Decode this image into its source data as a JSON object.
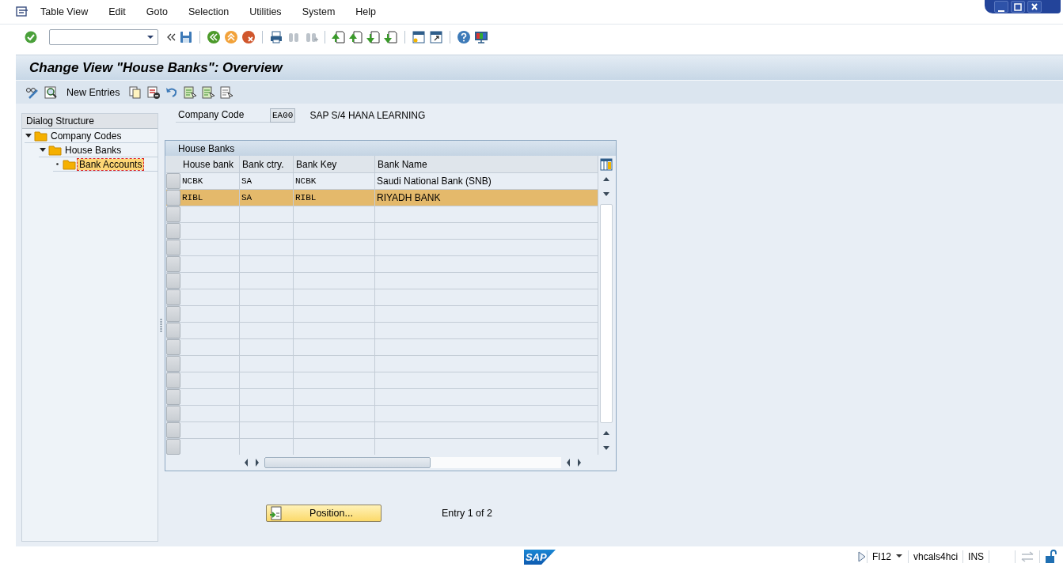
{
  "menu": [
    "Table View",
    "Edit",
    "Goto",
    "Selection",
    "Utilities",
    "System",
    "Help"
  ],
  "title": "Change View \"House Banks\": Overview",
  "app_toolbar": {
    "new_entries": "New Entries"
  },
  "dialog_structure": {
    "title": "Dialog Structure",
    "tree": [
      {
        "label": "Company Codes",
        "expanded": true,
        "selected": false,
        "children": [
          {
            "label": "House Banks",
            "expanded": true,
            "selected": false,
            "children": [
              {
                "label": "Bank Accounts",
                "selected": true
              }
            ]
          }
        ]
      }
    ]
  },
  "company_code": {
    "label": "Company Code",
    "value": "EA00",
    "description": "SAP S/4 HANA LEARNING"
  },
  "table": {
    "title": "House Banks",
    "columns": [
      "House bank",
      "Bank ctry.",
      "Bank Key",
      "Bank Name"
    ],
    "rows": [
      {
        "cells": [
          "NCBK",
          "SA",
          "NCBK",
          "Saudi National Bank (SNB)"
        ],
        "selected": false
      },
      {
        "cells": [
          "RIBL",
          "SA",
          "RIBL",
          "RIYADH BANK"
        ],
        "selected": true
      }
    ]
  },
  "position_button": "Position...",
  "entry_info": "Entry 1 of 2",
  "status_bar": {
    "logo": "SAP",
    "transaction": "FI12",
    "server": "vhcals4hci",
    "mode": "INS"
  }
}
